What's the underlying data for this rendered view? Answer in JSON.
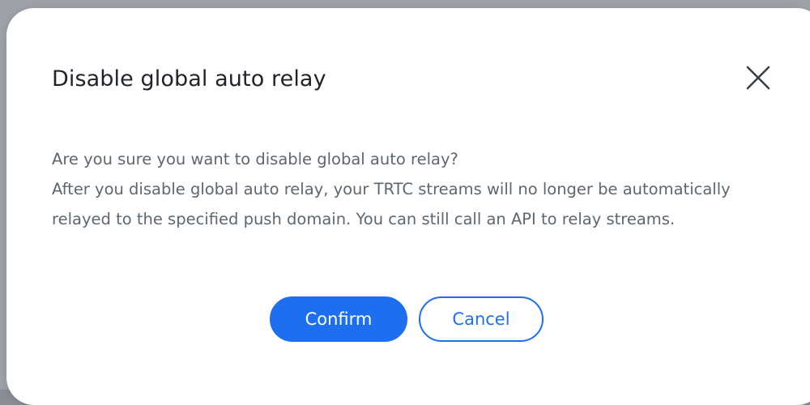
{
  "dialog": {
    "title": "Disable global auto relay",
    "close_icon": "close-icon",
    "body_line1": "Are you sure you want to disable global auto relay?",
    "body_line2": "After you disable global auto relay, your TRTC streams will no longer be automatically relayed to the specified push domain. You can still call an API to relay streams.",
    "confirm_label": "Confirm",
    "cancel_label": "Cancel"
  },
  "colors": {
    "primary": "#1e6ff0",
    "title_text": "#1f2329",
    "body_text": "#5f6670",
    "background": "#ffffff"
  }
}
